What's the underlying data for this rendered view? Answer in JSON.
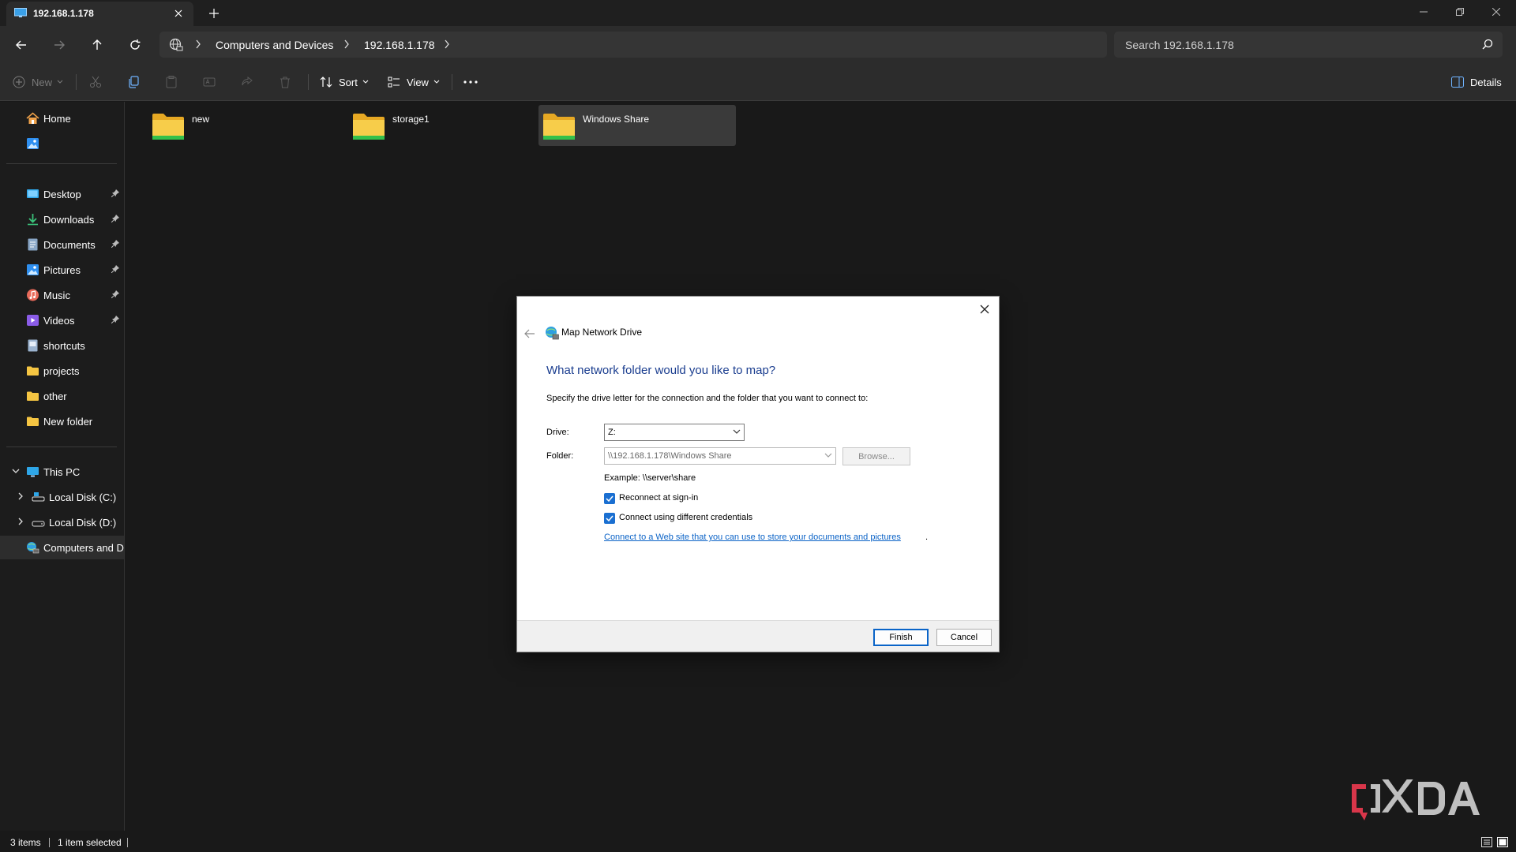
{
  "tab": {
    "title": "192.168.1.178"
  },
  "address": {
    "crumbs": [
      "Computers and Devices",
      "192.168.1.178"
    ],
    "search_placeholder": "Search 192.168.1.178"
  },
  "toolbar": {
    "new_label": "New",
    "sort_label": "Sort",
    "view_label": "View",
    "details_label": "Details"
  },
  "sidebar": {
    "quick": [
      {
        "label": "Home",
        "icon": "home-icon"
      },
      {
        "label": "",
        "icon": "gallery-icon"
      }
    ],
    "pinned": [
      {
        "label": "Desktop",
        "icon": "desktop-icon"
      },
      {
        "label": "Downloads",
        "icon": "downloads-icon"
      },
      {
        "label": "Documents",
        "icon": "documents-icon"
      },
      {
        "label": "Pictures",
        "icon": "pictures-icon"
      },
      {
        "label": "Music",
        "icon": "music-icon"
      },
      {
        "label": "Videos",
        "icon": "videos-icon"
      },
      {
        "label": "shortcuts",
        "icon": "shortcut-file-icon"
      },
      {
        "label": "projects",
        "icon": "folder-icon"
      },
      {
        "label": "other",
        "icon": "folder-icon"
      },
      {
        "label": "New folder",
        "icon": "folder-icon"
      }
    ],
    "tree": [
      {
        "label": "This PC",
        "icon": "pc-icon"
      },
      {
        "label": "Local Disk (C:)",
        "icon": "drive-icon"
      },
      {
        "label": "Local Disk (D:)",
        "icon": "drive-icon"
      },
      {
        "label": "Computers and Devices",
        "icon": "network-icon"
      }
    ]
  },
  "content": {
    "items": [
      {
        "label": "new"
      },
      {
        "label": "storage1"
      },
      {
        "label": "Windows Share"
      }
    ]
  },
  "status": {
    "count": "3 items",
    "selected": "1 item selected"
  },
  "dialog": {
    "title": "Map Network Drive",
    "heading": "What network folder would you like to map?",
    "instruction": "Specify the drive letter for the connection and the folder that you want to connect to:",
    "drive_label": "Drive:",
    "drive_value": "Z:",
    "folder_label": "Folder:",
    "folder_value": "\\\\192.168.1.178\\Windows Share",
    "browse_label": "Browse...",
    "example": "Example: \\\\server\\share",
    "reconnect_label": "Reconnect at sign-in",
    "reconnect_checked": true,
    "credentials_label": "Connect using different credentials",
    "credentials_checked": true,
    "link_text": "Connect to a Web site that you can use to store your documents and pictures",
    "link_suffix": ".",
    "finish_label": "Finish",
    "cancel_label": "Cancel"
  },
  "colors": {
    "accent": "#1a6fd1",
    "heading_blue": "#1a3d8f",
    "folder_yellow": "#f5c542",
    "share_green": "#35c04a"
  }
}
